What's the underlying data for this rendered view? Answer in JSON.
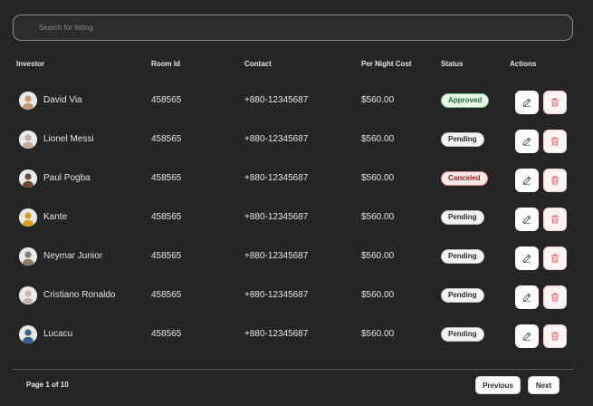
{
  "search": {
    "placeholder": "Search for listing"
  },
  "table": {
    "headers": {
      "investor": "Investor",
      "room_id": "Room Id",
      "contact": "Contact",
      "per_night_cost": "Per Night Cost",
      "status": "Status",
      "actions": "Actions"
    },
    "rows": [
      {
        "name": "David Via",
        "room_id": "458565",
        "contact": "+880-12345687",
        "cost": "$560.00",
        "status": "Approved",
        "status_kind": "approved",
        "avatar_color": "#c89a72"
      },
      {
        "name": "Lionel Messi",
        "room_id": "458565",
        "contact": "+880-12345687",
        "cost": "$560.00",
        "status": "Pending",
        "status_kind": "pending",
        "avatar_color": "#bfae9c"
      },
      {
        "name": "Paul Pogba",
        "room_id": "458565",
        "contact": "+880-12345687",
        "cost": "$560.00",
        "status": "Canceled",
        "status_kind": "canceled",
        "avatar_color": "#6b4a3a"
      },
      {
        "name": "Kante",
        "room_id": "458565",
        "contact": "+880-12345687",
        "cost": "$560.00",
        "status": "Pending",
        "status_kind": "pending",
        "avatar_color": "#d8a020"
      },
      {
        "name": "Neymar Junior",
        "room_id": "458565",
        "contact": "+880-12345687",
        "cost": "$560.00",
        "status": "Pending",
        "status_kind": "pending",
        "avatar_color": "#8b7f6a"
      },
      {
        "name": "Cristiano Ronaldo",
        "room_id": "458565",
        "contact": "+880-12345687",
        "cost": "$560.00",
        "status": "Pending",
        "status_kind": "pending",
        "avatar_color": "#c9b8a8"
      },
      {
        "name": "Lucacu",
        "room_id": "458565",
        "contact": "+880-12345687",
        "cost": "$560.00",
        "status": "Pending",
        "status_kind": "pending",
        "avatar_color": "#3c5f8c"
      }
    ]
  },
  "pagination": {
    "page_info": "Page 1 of 10",
    "previous_label": "Previous",
    "next_label": "Next"
  },
  "colors": {
    "background": "#252525",
    "delete_icon": "#e25c5c",
    "edit_icon": "#555555"
  },
  "icons": {
    "edit": "pencil-icon",
    "delete": "trash-icon"
  }
}
